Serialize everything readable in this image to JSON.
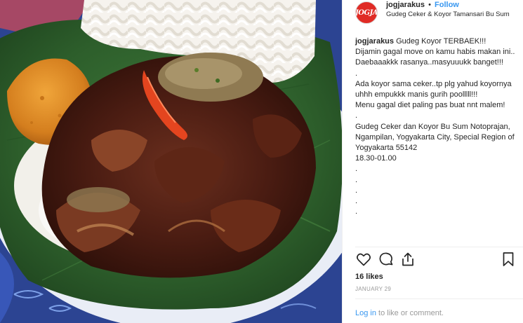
{
  "header": {
    "username": "jogjarakus",
    "separator": "•",
    "follow_label": "Follow",
    "location": "Gudeg Ceker & Koyor Tamansari Bu Sum",
    "avatar_text": "JOGJA"
  },
  "caption": {
    "username": "jogjarakus",
    "text": " Gudeg Koyor TERBAEK!!!\nDijamin gagal move on kamu habis makan ini.. Daebaaakkk rasanya..masyuuukk banget!!!\n.\nAda koyor sama ceker..tp plg yahud koyornya uhhh empukkk manis gurih poolllll!!!\nMenu gagal diet paling pas buat nnt malem!\n.\nGudeg Ceker dan Koyor Bu Sum Notoprajan, Ngampilan, Yogyakarta City, Special Region of Yogyakarta 55142\n18.30-01.00\n.\n.\n.\n.\n."
  },
  "actions": {
    "like_icon": "heart-icon",
    "comment_icon": "comment-bubble-icon",
    "share_icon": "share-icon",
    "save_icon": "bookmark-icon"
  },
  "likes_text": "16 likes",
  "date_text": "JANUARY 29",
  "login": {
    "link_text": "Log in",
    "rest_text": " to like or comment."
  },
  "colors": {
    "link": "#3897f0",
    "muted": "#999999",
    "text": "#262626",
    "avatar_bg": "#e02b25"
  }
}
